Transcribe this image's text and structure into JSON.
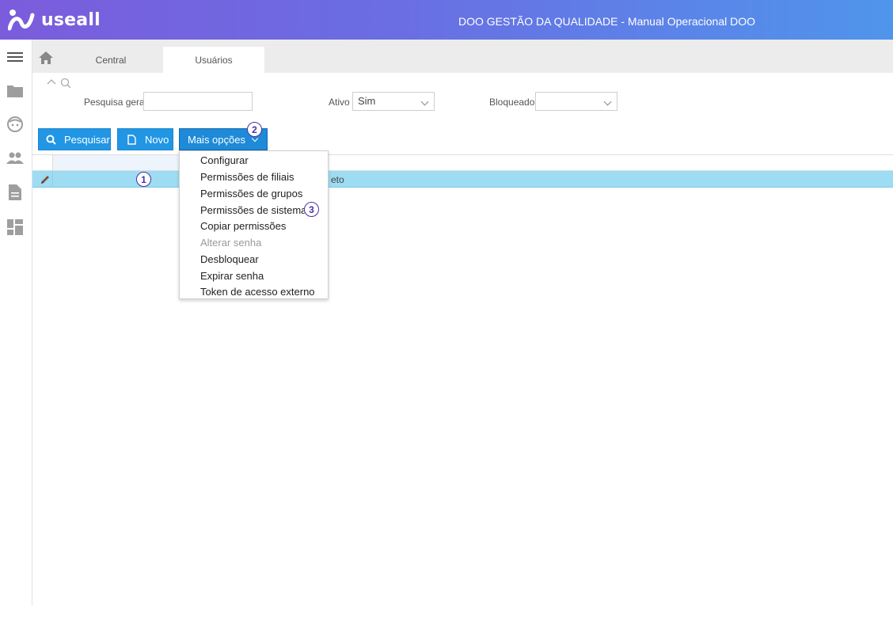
{
  "header": {
    "logo_text": "useall",
    "app_title": "DOO GESTÃO DA QUALIDADE - Manual Operacional DOO",
    "gradient_start": "#7b5cdc",
    "gradient_end": "#4f95ec"
  },
  "rail": {
    "icons": [
      "menu-icon",
      "folder-icon",
      "face-icon",
      "people-icon",
      "document-icon",
      "dashboard-icon"
    ]
  },
  "tabs": {
    "home_icon": "home-icon",
    "items": [
      {
        "label": "Central"
      },
      {
        "label": "Usuários",
        "active": true
      }
    ]
  },
  "filters": {
    "pesquisa_geral_label": "Pesquisa geral",
    "pesquisa_geral_value": "",
    "ativo_label": "Ativo",
    "ativo_value": "Sim",
    "bloqueado_label": "Bloqueado",
    "bloqueado_value": ""
  },
  "toolbar": {
    "pesquisar_label": "Pesquisar",
    "novo_label": "Novo",
    "mais_opcoes_label": "Mais opções",
    "button_color": "#2196e4"
  },
  "grid": {
    "rows": [
      {
        "text": "eto",
        "selected": true
      }
    ],
    "selected_color": "#9ddcf2"
  },
  "menu": {
    "items": [
      {
        "label": "Configurar",
        "enabled": true
      },
      {
        "label": "Permissões de filiais",
        "enabled": true
      },
      {
        "label": "Permissões de grupos",
        "enabled": true
      },
      {
        "label": "Permissões de sistemas",
        "enabled": true
      },
      {
        "label": "Copiar permissões",
        "enabled": true
      },
      {
        "label": "Alterar senha",
        "enabled": false
      },
      {
        "label": "Desbloquear",
        "enabled": true
      },
      {
        "label": "Expirar senha",
        "enabled": true
      },
      {
        "label": "Token de acesso externo",
        "enabled": true
      }
    ]
  },
  "callouts": {
    "one": "1",
    "two": "2",
    "three": "3",
    "color": "#4b2fa8"
  }
}
